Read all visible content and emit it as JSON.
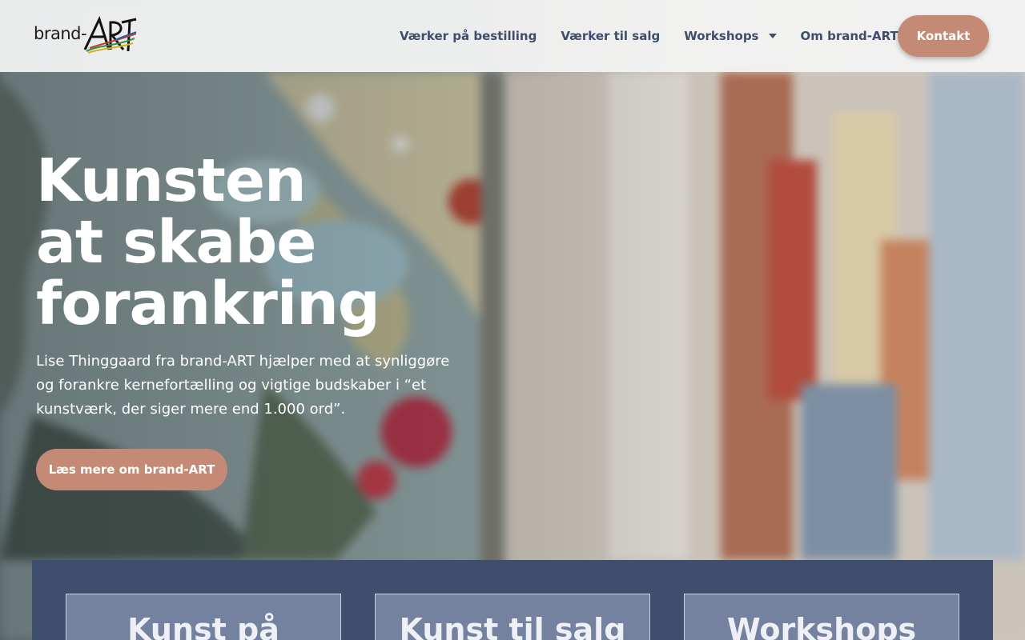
{
  "brand": {
    "logo_text": "brand-",
    "logo_mark": "ART",
    "colors": {
      "accent": "#c48a75",
      "navy": "#3e4e6c",
      "nav_text": "#3d4d6b"
    }
  },
  "nav": {
    "items": [
      {
        "label": "Værker på bestilling"
      },
      {
        "label": "Værker til salg"
      },
      {
        "label": "Workshops",
        "icon": "chevron-down-icon"
      },
      {
        "label": "Om brand-ART"
      }
    ],
    "contact_label": "Kontakt"
  },
  "hero": {
    "title_lines": [
      "Kunsten",
      "at skabe",
      "forankring"
    ],
    "text": "Lise Thinggaard fra brand-ART hjælper med at synliggøre og forankre kernefortælling og vigtige budskaber i “et kunstværk, der siger mere end 1.000 ord”.",
    "button_label": "Læs mere om brand-ART"
  },
  "services": {
    "cards": [
      {
        "title": "Kunst på"
      },
      {
        "title": "Kunst til salg"
      },
      {
        "title": "Workshops"
      }
    ]
  }
}
